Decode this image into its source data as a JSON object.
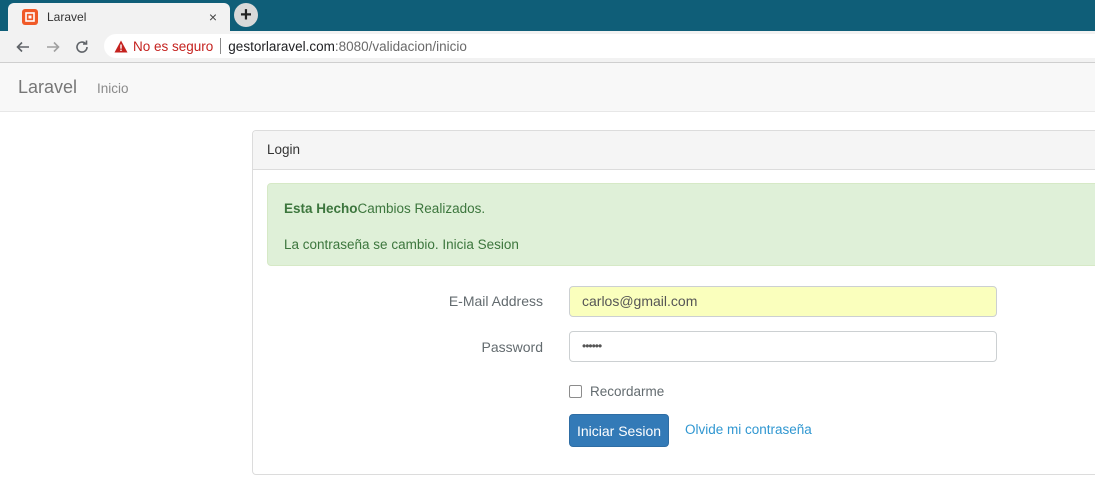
{
  "browser": {
    "tab_title": "Laravel",
    "tab_close": "×",
    "new_tab": "+",
    "security_label": "No es seguro",
    "url_host": "gestorlaravel.com",
    "url_rest": ":8080/validacion/inicio"
  },
  "navbar": {
    "brand": "Laravel",
    "links": [
      "Inicio"
    ]
  },
  "panel": {
    "heading": "Login",
    "alert": {
      "strong": "Esta Hecho",
      "message": "Cambios Realizados.",
      "detail": "La contraseña se cambio. Inicia Sesion"
    },
    "form": {
      "email_label": "E-Mail Address",
      "email_value": "carlos@gmail.com",
      "password_label": "Password",
      "password_value": "••••••",
      "remember_label": "Recordarme",
      "submit_label": "Iniciar Sesion",
      "forgot_label": "Olvide mi contraseña"
    }
  },
  "colors": {
    "chrome_tabstrip": "#0f5e78",
    "alert_bg": "#dff0d8",
    "alert_text": "#3c763d",
    "button_bg": "#337ab7",
    "link": "#3097d1",
    "security_warning": "#c5221f"
  }
}
